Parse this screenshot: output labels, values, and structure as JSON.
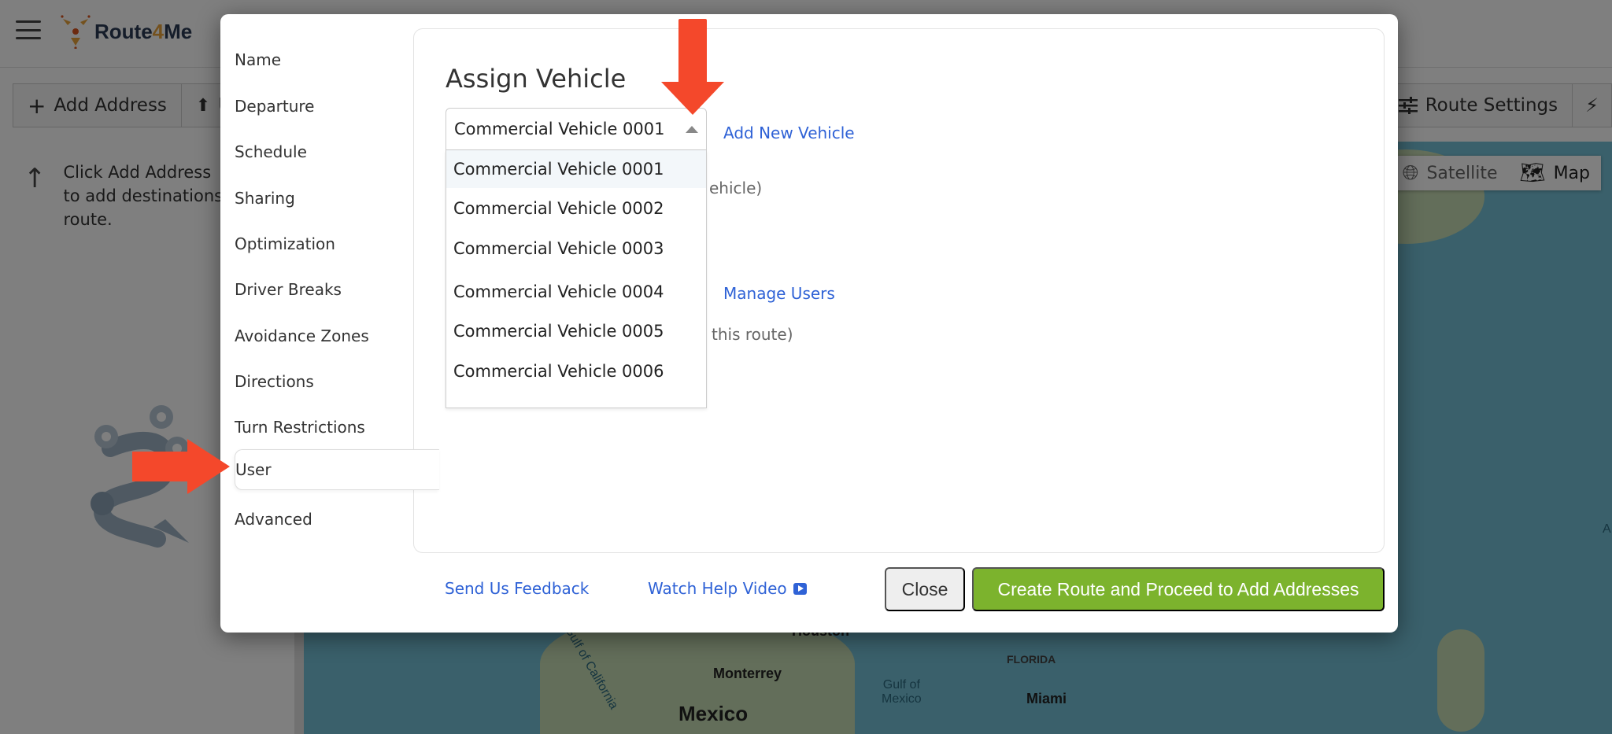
{
  "app": {
    "logo_text_a": "Route",
    "logo_text_b": "4",
    "logo_text_c": "Me"
  },
  "toolbar": {
    "add_address": "Add Address",
    "upload_partial": "U",
    "route_settings": "Route Settings"
  },
  "left_panel": {
    "hint_line1": "Click Add Address",
    "hint_line2": "to add destinations",
    "hint_line3": "route."
  },
  "map": {
    "satellite_label": "Satellite",
    "map_label": "Map",
    "labels": {
      "houston": "Houston",
      "gulf_of_california": "Gulf of California",
      "monterrey": "Monterrey",
      "mexico": "Mexico",
      "gulf_of_mexico_1": "Gulf of",
      "gulf_of_mexico_2": "Mexico",
      "florida": "FLORIDA",
      "miami": "Miami",
      "edge": "A"
    }
  },
  "modal": {
    "nav": [
      {
        "label": "Name"
      },
      {
        "label": "Departure"
      },
      {
        "label": "Schedule"
      },
      {
        "label": "Sharing"
      },
      {
        "label": "Optimization"
      },
      {
        "label": "Driver Breaks"
      },
      {
        "label": "Avoidance Zones"
      },
      {
        "label": "Directions"
      },
      {
        "label": "Turn Restrictions"
      },
      {
        "label": "User"
      },
      {
        "label": "Advanced"
      }
    ],
    "active_nav": "User",
    "card": {
      "title": "Assign Vehicle",
      "vehicle_select_value": "Commercial Vehicle 0001",
      "add_new_vehicle": "Add New Vehicle",
      "vehicle_hint_partial": "ehicle)",
      "manage_users": "Manage Users",
      "user_hint_partial": "this route)",
      "vehicle_options": [
        "Commercial Vehicle 0001",
        "Commercial Vehicle 0002",
        "Commercial Vehicle 0003",
        "Commercial Vehicle 0004",
        "Commercial Vehicle 0005",
        "Commercial Vehicle 0006"
      ],
      "highlighted_option": "Commercial Vehicle 0001"
    },
    "footer": {
      "send_feedback": "Send Us Feedback",
      "watch_video": "Watch Help Video",
      "close": "Close",
      "create_route": "Create Route and Proceed to Add Addresses"
    }
  },
  "colors": {
    "accent_green": "#7cb32d",
    "link_blue": "#2f62d6",
    "annotation_red": "#f4482b",
    "logo_navy": "#2b3a55",
    "logo_orange": "#e8a23a"
  }
}
